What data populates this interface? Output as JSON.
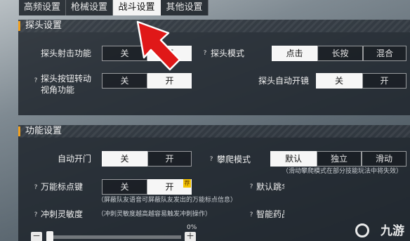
{
  "tabs": [
    {
      "label": "高频设置"
    },
    {
      "label": "枪械设置"
    },
    {
      "label": "战斗设置"
    },
    {
      "label": "其他设置"
    }
  ],
  "scope_section": {
    "title": "探头设置",
    "scope_fire": {
      "label": "探头射击功能",
      "off": "关",
      "on": "开",
      "selected": "开"
    },
    "scope_mode": {
      "label": "探头模式",
      "options": [
        "点击",
        "长按",
        "混合"
      ],
      "selected": "点击"
    },
    "scope_button_rotate": {
      "label_line1": "探头按钮转动",
      "label_line2": "视角功能",
      "off": "关",
      "on": "开",
      "selected": "开"
    },
    "scope_auto_open": {
      "label": "探头自动开镜",
      "off": "关",
      "on": "开",
      "selected": "关"
    }
  },
  "function_section": {
    "title": "功能设置",
    "auto_door": {
      "label": "自动开门",
      "off": "关",
      "on": "开",
      "selected": "关"
    },
    "climb_mode": {
      "label": "攀爬模式",
      "options": [
        "默认",
        "独立",
        "滑动"
      ],
      "selected": "默认",
      "note": "（滑动攀爬模式在部分技能玩法中将失效）"
    },
    "marker_key": {
      "label": "万能标点键",
      "off": "关",
      "on": "开",
      "selected": "开",
      "badge": "荐",
      "note": "（屏蔽队友语音可屏蔽队友发出的万能标点信息）"
    },
    "default_partial": {
      "label": "默认跳伞"
    },
    "sprint_sensitivity": {
      "label": "冲刺灵敏度",
      "note": "（冲刺灵敏度越高越容易触发冲刺操作）",
      "value": "0%",
      "minus": "－",
      "plus": "＋"
    },
    "smart_partial": {
      "label": "智能药品"
    }
  },
  "watermark": {
    "text": "九游"
  },
  "colors": {
    "accent": "#f0a020",
    "arrow": "#e01818",
    "active_bg": "#f6f6f6"
  }
}
